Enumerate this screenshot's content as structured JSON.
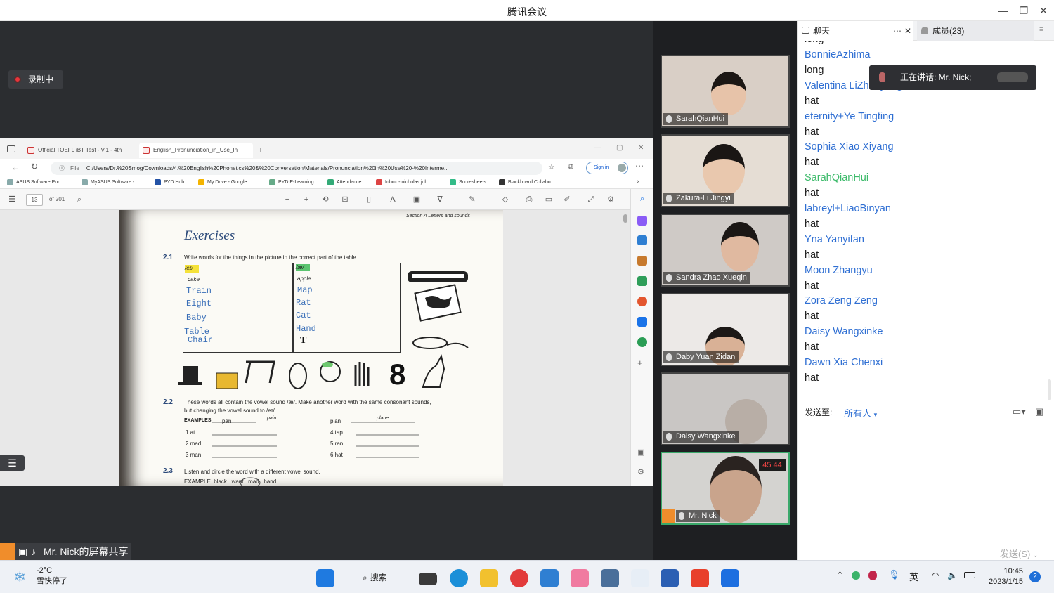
{
  "window": {
    "title": "腾讯会议"
  },
  "recording": {
    "label": "录制中"
  },
  "browser": {
    "tabs": [
      {
        "label": "Official TOEFL iBT Test - V.1 - 4th"
      },
      {
        "label": "English_Pronunciation_in_Use_In"
      }
    ],
    "file_label": "File",
    "address": "C:/Users/Dr.%20Smog/Downloads/4.%20English%20Phonetics%20&%20Conversation/Materials/Pronunciation%20in%20Use%20-%20Interme...",
    "sign_in": "Sign in",
    "bookmarks": [
      "ASUS Software Port...",
      "MyASUS Software -...",
      "PYD Hub",
      "My Drive - Google...",
      "PYD E-Learning",
      "Attendance",
      "Inbox - nicholas.joh...",
      "Scoresheets",
      "Blackboard Collabo..."
    ],
    "pdf": {
      "page": "13",
      "of": "of 201"
    }
  },
  "pdf_page": {
    "header": "Section A  Letters and sounds",
    "title": "Exercises",
    "ex1_num": "2.1",
    "ex1_text": "Write words for the things in the picture in the correct part of the table.",
    "col1_head": "/eɪ/",
    "col2_head": "/æ/",
    "col1_words": [
      "cake",
      "Train",
      "Eight",
      "Baby",
      "Table",
      "Chair"
    ],
    "col2_words": [
      "apple",
      "Map",
      "Rat",
      "Cat",
      "Hand",
      "T"
    ],
    "ex2_num": "2.2",
    "ex2_text1": "These words all contain the vowel sound /æ/. Make another word with the same consonant sounds,",
    "ex2_text2": "but changing the vowel sound to /eɪ/.",
    "example_label": "EXAMPLES",
    "ex_left": [
      "pan",
      "1  at",
      "2  mad",
      "3  man"
    ],
    "ex_left_ans": "pain",
    "ex_right": [
      "plan",
      "4  tap",
      "5  ran",
      "6  hat"
    ],
    "ex_right_ans": "plane",
    "ex3_num": "2.3",
    "ex3_text": "Listen and circle the word with a different vowel sound.",
    "ex3_example": "EXAMPLE  black   want   mad   hand"
  },
  "sharer": {
    "label": "Mr. Nick的屏幕共享"
  },
  "participants": [
    {
      "name": "SarahQianHui"
    },
    {
      "name": "Zakura-Li Jingyi"
    },
    {
      "name": "Sandra Zhao Xueqin"
    },
    {
      "name": "Daby Yuan Zidan"
    },
    {
      "name": "Daisy Wangxinke"
    },
    {
      "name": "Mr. Nick"
    }
  ],
  "chat": {
    "tab_chat": "聊天",
    "tab_members": "成员(23)",
    "speaking": "正在讲话: Mr. Nick;",
    "messages": [
      {
        "sender": "BonnieAzhima",
        "body": "long"
      },
      {
        "sender": "Valentina LiZhenyang",
        "body": "hat"
      },
      {
        "sender": "eternity+Ye Tingting",
        "body": "hat"
      },
      {
        "sender": "Sophia Xiao Xiyang",
        "body": "hat"
      },
      {
        "sender": "SarahQianHui",
        "body": "hat"
      },
      {
        "sender": "labreyl+LiaoBinyan",
        "body": "hat"
      },
      {
        "sender": "Yna Yanyifan",
        "body": "hat"
      },
      {
        "sender": "Moon Zhangyu",
        "body": "hat"
      },
      {
        "sender": "Zora Zeng Zeng",
        "body": "hat"
      },
      {
        "sender": "Daisy Wangxinke",
        "body": "hat"
      },
      {
        "sender": "Dawn Xia Chenxi",
        "body": "hat"
      }
    ],
    "top_partial": "long",
    "send_to_label": "发送至:",
    "recipient": "所有人",
    "send_button": "发送(S)"
  },
  "taskbar": {
    "temp": "-2°C",
    "weather": "雪快停了",
    "search": "搜索",
    "ime": "英",
    "time": "10:45",
    "date": "2023/1/15",
    "badge": "2"
  }
}
